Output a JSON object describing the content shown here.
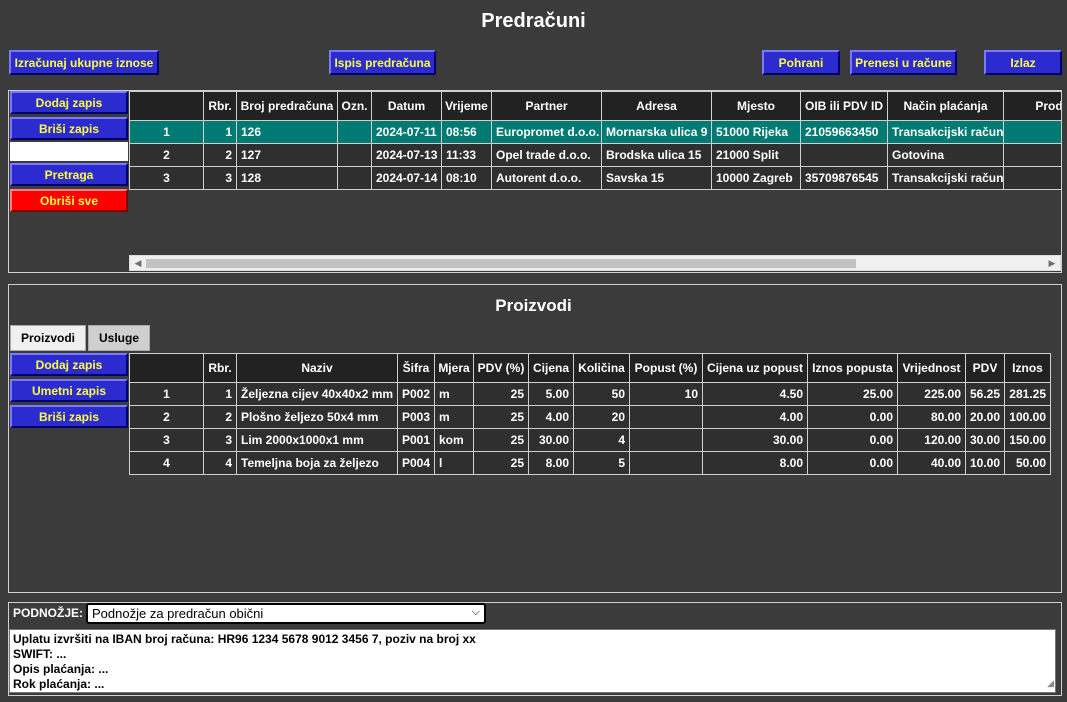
{
  "title": "Predračuni",
  "toolbar": {
    "calc_label": "Izračunaj ukupne iznose",
    "print_label": "Ispis predračuna",
    "save_label": "Pohrani",
    "transfer_label": "Prenesi u račune",
    "exit_label": "Izlaz"
  },
  "invoice_side": {
    "add_label": "Dodaj zapis",
    "delete_label": "Briši zapis",
    "search_value": "",
    "search_label": "Pretraga",
    "clear_label": "Obriši sve"
  },
  "invoices": {
    "columns": [
      "",
      "Rbr.",
      "Broj predračuna",
      "Ozn.",
      "Datum",
      "Vrijeme",
      "Partner",
      "Adresa",
      "Mjesto",
      "OIB ili PDV ID",
      "Način plaćanja",
      "Prodava"
    ],
    "rows": [
      [
        "1",
        "1",
        "126",
        "",
        "2024-07-11",
        "08:56",
        "Europromet d.o.o.",
        "Mornarska ulica 9",
        "51000 Rijeka",
        "21059663450",
        "Transakcijski račun",
        ""
      ],
      [
        "2",
        "2",
        "127",
        "",
        "2024-07-13",
        "11:33",
        "Opel trade d.o.o.",
        "Brodska ulica 15",
        "21000 Split",
        "",
        "Gotovina",
        ""
      ],
      [
        "3",
        "3",
        "128",
        "",
        "2024-07-14",
        "08:10",
        "Autorent d.o.o.",
        "Savska 15",
        "10000 Zagreb",
        "35709876545",
        "Transakcijski račun",
        ""
      ]
    ]
  },
  "products_section": {
    "title": "Proizvodi",
    "tabs": [
      "Proizvodi",
      "Usluge"
    ],
    "add_label": "Dodaj zapis",
    "insert_label": "Umetni zapis",
    "delete_label": "Briši zapis",
    "columns": [
      "",
      "Rbr.",
      "Naziv",
      "Šifra",
      "Mjera",
      "PDV (%)",
      "Cijena",
      "Količina",
      "Popust (%)",
      "Cijena uz popust",
      "Iznos popusta",
      "Vrijednost",
      "PDV",
      "Iznos"
    ],
    "rows": [
      [
        "1",
        "1",
        "Željezna cijev 40x40x2 mm",
        "P002",
        "m",
        "25",
        "5.00",
        "50",
        "10",
        "4.50",
        "25.00",
        "225.00",
        "56.25",
        "281.25"
      ],
      [
        "2",
        "2",
        "Plošno željezo 50x4 mm",
        "P003",
        "m",
        "25",
        "4.00",
        "20",
        "",
        "4.00",
        "0.00",
        "80.00",
        "20.00",
        "100.00"
      ],
      [
        "3",
        "3",
        "Lim 2000x1000x1 mm",
        "P001",
        "kom",
        "25",
        "30.00",
        "4",
        "",
        "30.00",
        "0.00",
        "120.00",
        "30.00",
        "150.00"
      ],
      [
        "4",
        "4",
        "Temeljna boja za željezo",
        "P004",
        "l",
        "25",
        "8.00",
        "5",
        "",
        "8.00",
        "0.00",
        "40.00",
        "10.00",
        "50.00"
      ]
    ]
  },
  "footer": {
    "label": "PODNOŽJE:",
    "select_value": "Podnožje za predračun obični",
    "text_lines": [
      "Uplatu izvršiti na IBAN broj računa: HR96 1234 5678 9012 3456 7, poziv na broj xx",
      "SWIFT: ...",
      "Opis plaćanja: ...",
      "Rok plaćanja: ..."
    ]
  },
  "colors": {
    "background": "#3b3b3b",
    "button": "#2b2bd0",
    "button_text": "#ffff40",
    "danger": "#ff0000",
    "selected_row": "#007a73"
  }
}
